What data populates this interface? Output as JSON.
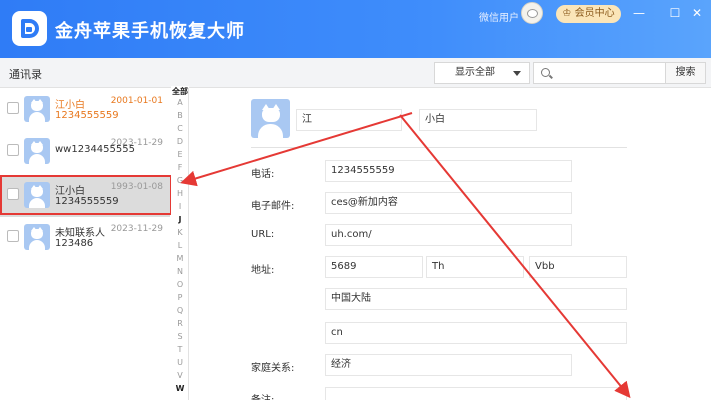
{
  "app": {
    "title": "金舟苹果手机恢复大师",
    "user_label": "微信用户",
    "vip_label": "会员中心",
    "window_buttons": [
      "—",
      "☐",
      "✕"
    ]
  },
  "toolbar": {
    "section_title": "通讯录",
    "filter_value": "显示全部",
    "search_placeholder": "",
    "search_button": "搜索"
  },
  "contacts": [
    {
      "name": "江小白",
      "phone": "1234555559",
      "date": "2001-01-01",
      "highlight": true,
      "selected": false
    },
    {
      "name": "ww1234455555",
      "phone": "",
      "date": "2023-11-29",
      "highlight": false,
      "selected": false
    },
    {
      "name": "江小白",
      "phone": "1234555559",
      "date": "1993-01-08",
      "highlight": false,
      "selected": true
    },
    {
      "name": "未知联系人",
      "phone": "123486",
      "date": "2023-11-29",
      "highlight": false,
      "selected": false
    }
  ],
  "alphabet": [
    "全部",
    "A",
    "B",
    "C",
    "D",
    "E",
    "F",
    "G",
    "H",
    "I",
    "J",
    "K",
    "L",
    "M",
    "N",
    "O",
    "P",
    "Q",
    "R",
    "S",
    "T",
    "U",
    "V",
    "W"
  ],
  "detail": {
    "last_name": "江",
    "first_name": "小白",
    "phone_label": "电话:",
    "phone": "1234555559",
    "email_label": "电子邮件:",
    "email": "ces@新加内容",
    "url_label": "URL:",
    "url": "uh.com/",
    "address_label": "地址:",
    "address_1": "5689",
    "address_2": "Th",
    "address_3": "Vbb",
    "address_country": "中国大陆",
    "address_code": "cn",
    "relation_label": "家庭关系:",
    "relation": "经济",
    "notes_label": "备注:"
  },
  "colors": {
    "accent": "#2f7cf6",
    "highlight": "#e8781e",
    "annotation": "#e53935"
  }
}
